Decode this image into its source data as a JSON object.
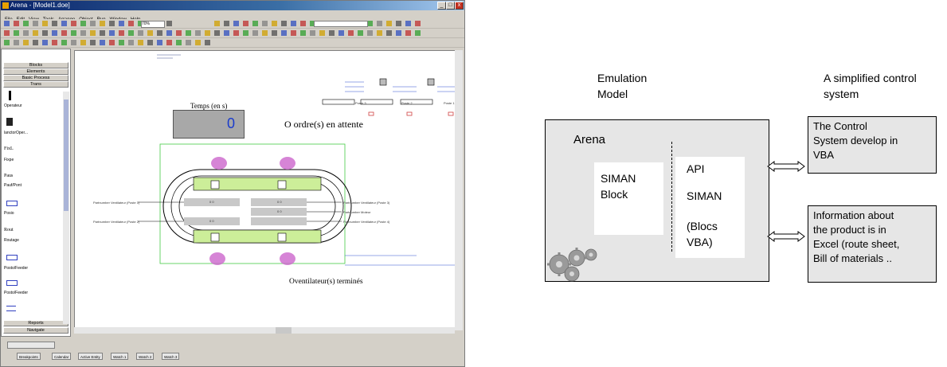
{
  "window": {
    "title": "Arena - [Model1.doe]",
    "menu": [
      "File",
      "Edit",
      "View",
      "Tools",
      "Arrange",
      "Object",
      "Run",
      "Window",
      "Help"
    ],
    "zoom": "70%"
  },
  "project_bar": {
    "categories": [
      "Blocks",
      "Elements",
      "Basic Process",
      "Trans"
    ],
    "modules": [
      "Operateur",
      "lanctorOper...",
      "Fixpe",
      "Pauf/Pont",
      "Posio",
      "Routage",
      "Posto/Feeder",
      "Posto/Feeder"
    ],
    "module_icon_labels": [
      "FixL",
      "Paus",
      "Rout"
    ],
    "bottom": [
      "Reports",
      "Navigate"
    ]
  },
  "canvas": {
    "time_label": "Temps (en s)",
    "time_value": "0",
    "orders_text": "O ordre(s) en attente",
    "fans_text": "Oventilateur(s) terminés",
    "left_labels": [
      "Partnumber Ventilateur (Poste 1)",
      "Partnumber Ventilateur (Poste 2)"
    ],
    "right_labels": [
      "Partnumber Ventilateur (Poste 3)",
      "Partnumber Moteur",
      "Partnumber Ventilateur (Poste 4)"
    ],
    "poste_labels": [
      "Poste 3",
      "Poste 2",
      "Poste 1"
    ],
    "counters": [
      "0 0",
      "0 0",
      "0 0",
      "0 0"
    ]
  },
  "bottom_tabs": [
    "Breakpoints",
    "Calendar",
    "Active Entity",
    "Watch 1",
    "Watch 2",
    "Watch 3"
  ],
  "diagram": {
    "emulation_model": [
      "Emulation",
      "Model"
    ],
    "control_system_title": [
      "A simplified control",
      "system"
    ],
    "arena_label": "Arena",
    "siman_block": [
      "SIMAN",
      "Block"
    ],
    "api_lines": [
      "API",
      "SIMAN",
      "(Blocs",
      "VBA)"
    ],
    "control_box": [
      "The Control",
      "System develop in",
      "VBA"
    ],
    "info_box": [
      "Information about",
      "the product is in",
      "Excel (route sheet,",
      "Bill of materials .."
    ]
  }
}
